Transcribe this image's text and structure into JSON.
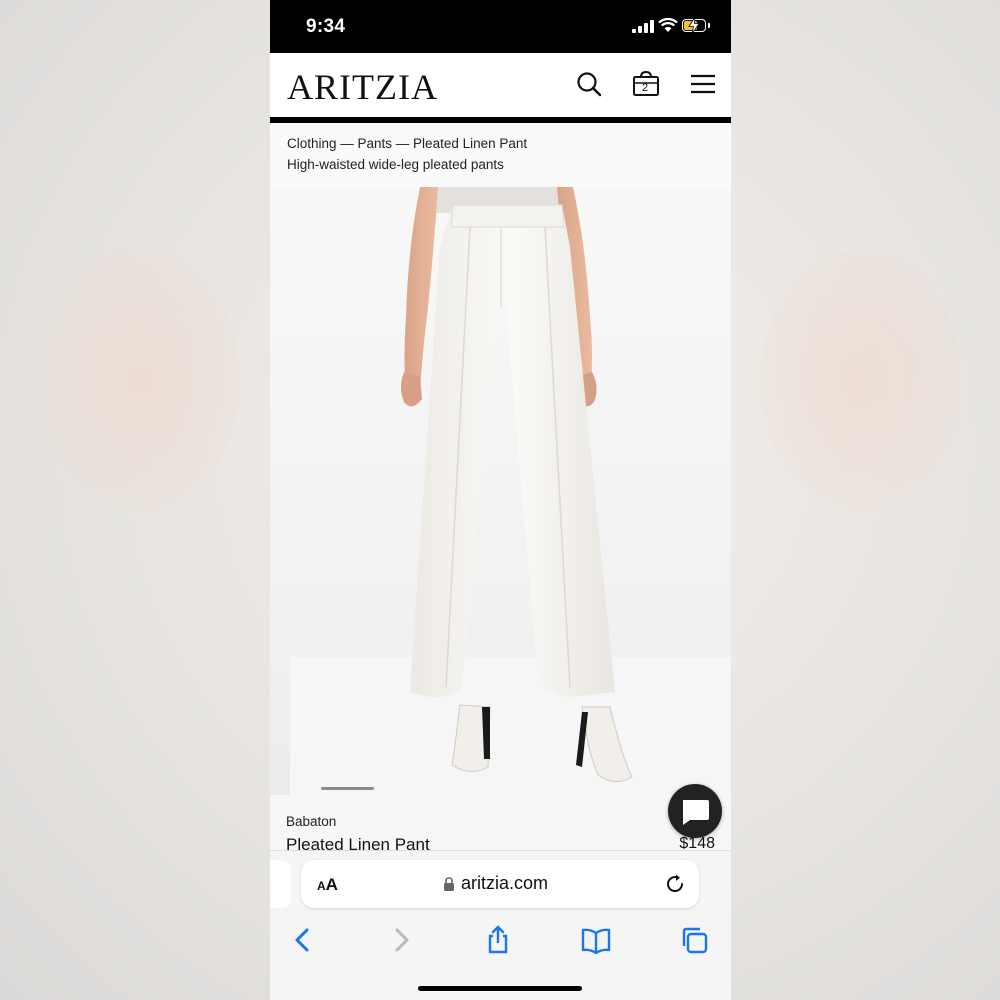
{
  "status_bar": {
    "time": "9:34",
    "battery_color": "#f4c02e"
  },
  "header": {
    "logo": "ARITZIA",
    "icons": [
      "search-icon",
      "bag-icon",
      "menu-icon"
    ],
    "bag_count": "2"
  },
  "breadcrumbs": {
    "path": "Clothing — Pants — Pleated Linen Pant",
    "subtitle": "High-waisted wide-leg pleated pants"
  },
  "product": {
    "brand": "Babaton",
    "name": "Pleated Linen Pant",
    "price": "$148"
  },
  "browser": {
    "text_size_label_large": "A",
    "text_size_label_small": "A",
    "url": "aritzia.com",
    "icons": [
      "back-icon",
      "forward-icon",
      "share-icon",
      "bookmarks-icon",
      "tabs-icon"
    ]
  }
}
